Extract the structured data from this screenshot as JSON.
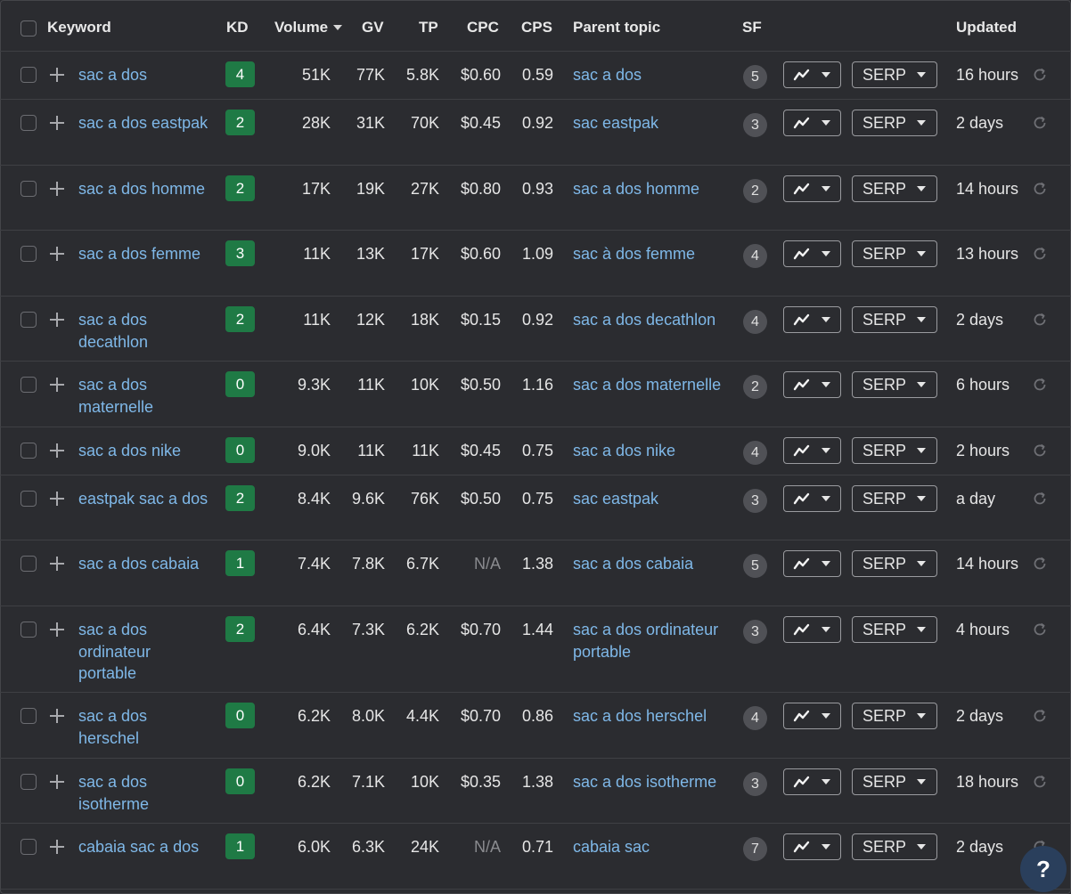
{
  "header": {
    "keyword": "Keyword",
    "kd": "KD",
    "volume": "Volume",
    "gv": "GV",
    "tp": "TP",
    "cpc": "CPC",
    "cps": "CPS",
    "parent_topic": "Parent topic",
    "sf": "SF",
    "updated": "Updated"
  },
  "icons": {
    "trend": "trend-chart-icon",
    "dropdown": "chevron-down-icon",
    "refresh": "refresh-icon",
    "add": "plus-icon",
    "help": "help-icon"
  },
  "colors": {
    "background": "#2b2c30",
    "link": "#7fb8e8",
    "kd_badge": "#1f7a45",
    "sf_badge": "#505156",
    "help_button": "#2a3f5c"
  },
  "serp_label": "SERP",
  "help_label": "?",
  "rows": [
    {
      "keyword": "sac a dos",
      "kd": "4",
      "volume": "51K",
      "gv": "77K",
      "tp": "5.8K",
      "cpc": "$0.60",
      "cps": "0.59",
      "parent_topic": "sac a dos",
      "sf": "5",
      "updated": "16 hours"
    },
    {
      "keyword": "sac a dos eastpak",
      "kd": "2",
      "volume": "28K",
      "gv": "31K",
      "tp": "70K",
      "cpc": "$0.45",
      "cps": "0.92",
      "parent_topic": "sac eastpak",
      "sf": "3",
      "updated": "2 days"
    },
    {
      "keyword": "sac a dos homme",
      "kd": "2",
      "volume": "17K",
      "gv": "19K",
      "tp": "27K",
      "cpc": "$0.80",
      "cps": "0.93",
      "parent_topic": "sac a dos homme",
      "sf": "2",
      "updated": "14 hours"
    },
    {
      "keyword": "sac a dos femme",
      "kd": "3",
      "volume": "11K",
      "gv": "13K",
      "tp": "17K",
      "cpc": "$0.60",
      "cps": "1.09",
      "parent_topic": "sac à dos femme",
      "sf": "4",
      "updated": "13 hours"
    },
    {
      "keyword": "sac a dos decathlon",
      "kd": "2",
      "volume": "11K",
      "gv": "12K",
      "tp": "18K",
      "cpc": "$0.15",
      "cps": "0.92",
      "parent_topic": "sac a dos decathlon",
      "sf": "4",
      "updated": "2 days"
    },
    {
      "keyword": "sac a dos maternelle",
      "kd": "0",
      "volume": "9.3K",
      "gv": "11K",
      "tp": "10K",
      "cpc": "$0.50",
      "cps": "1.16",
      "parent_topic": "sac a dos maternelle",
      "sf": "2",
      "updated": "6 hours"
    },
    {
      "keyword": "sac a dos nike",
      "kd": "0",
      "volume": "9.0K",
      "gv": "11K",
      "tp": "11K",
      "cpc": "$0.45",
      "cps": "0.75",
      "parent_topic": "sac a dos nike",
      "sf": "4",
      "updated": "2 hours"
    },
    {
      "keyword": "eastpak sac a dos",
      "kd": "2",
      "volume": "8.4K",
      "gv": "9.6K",
      "tp": "76K",
      "cpc": "$0.50",
      "cps": "0.75",
      "parent_topic": "sac eastpak",
      "sf": "3",
      "updated": "a day"
    },
    {
      "keyword": "sac a dos cabaia",
      "kd": "1",
      "volume": "7.4K",
      "gv": "7.8K",
      "tp": "6.7K",
      "cpc": "N/A",
      "cps": "1.38",
      "parent_topic": "sac a dos cabaia",
      "sf": "5",
      "updated": "14 hours"
    },
    {
      "keyword": "sac a dos ordinateur portable",
      "kd": "2",
      "volume": "6.4K",
      "gv": "7.3K",
      "tp": "6.2K",
      "cpc": "$0.70",
      "cps": "1.44",
      "parent_topic": "sac a dos ordinateur portable",
      "sf": "3",
      "updated": "4 hours"
    },
    {
      "keyword": "sac a dos herschel",
      "kd": "0",
      "volume": "6.2K",
      "gv": "8.0K",
      "tp": "4.4K",
      "cpc": "$0.70",
      "cps": "0.86",
      "parent_topic": "sac a dos herschel",
      "sf": "4",
      "updated": "2 days"
    },
    {
      "keyword": "sac a dos isotherme",
      "kd": "0",
      "volume": "6.2K",
      "gv": "7.1K",
      "tp": "10K",
      "cpc": "$0.35",
      "cps": "1.38",
      "parent_topic": "sac a dos isotherme",
      "sf": "3",
      "updated": "18 hours"
    },
    {
      "keyword": "cabaia sac a dos",
      "kd": "1",
      "volume": "6.0K",
      "gv": "6.3K",
      "tp": "24K",
      "cpc": "N/A",
      "cps": "0.71",
      "parent_topic": "cabaia sac",
      "sf": "7",
      "updated": "2 days"
    }
  ]
}
